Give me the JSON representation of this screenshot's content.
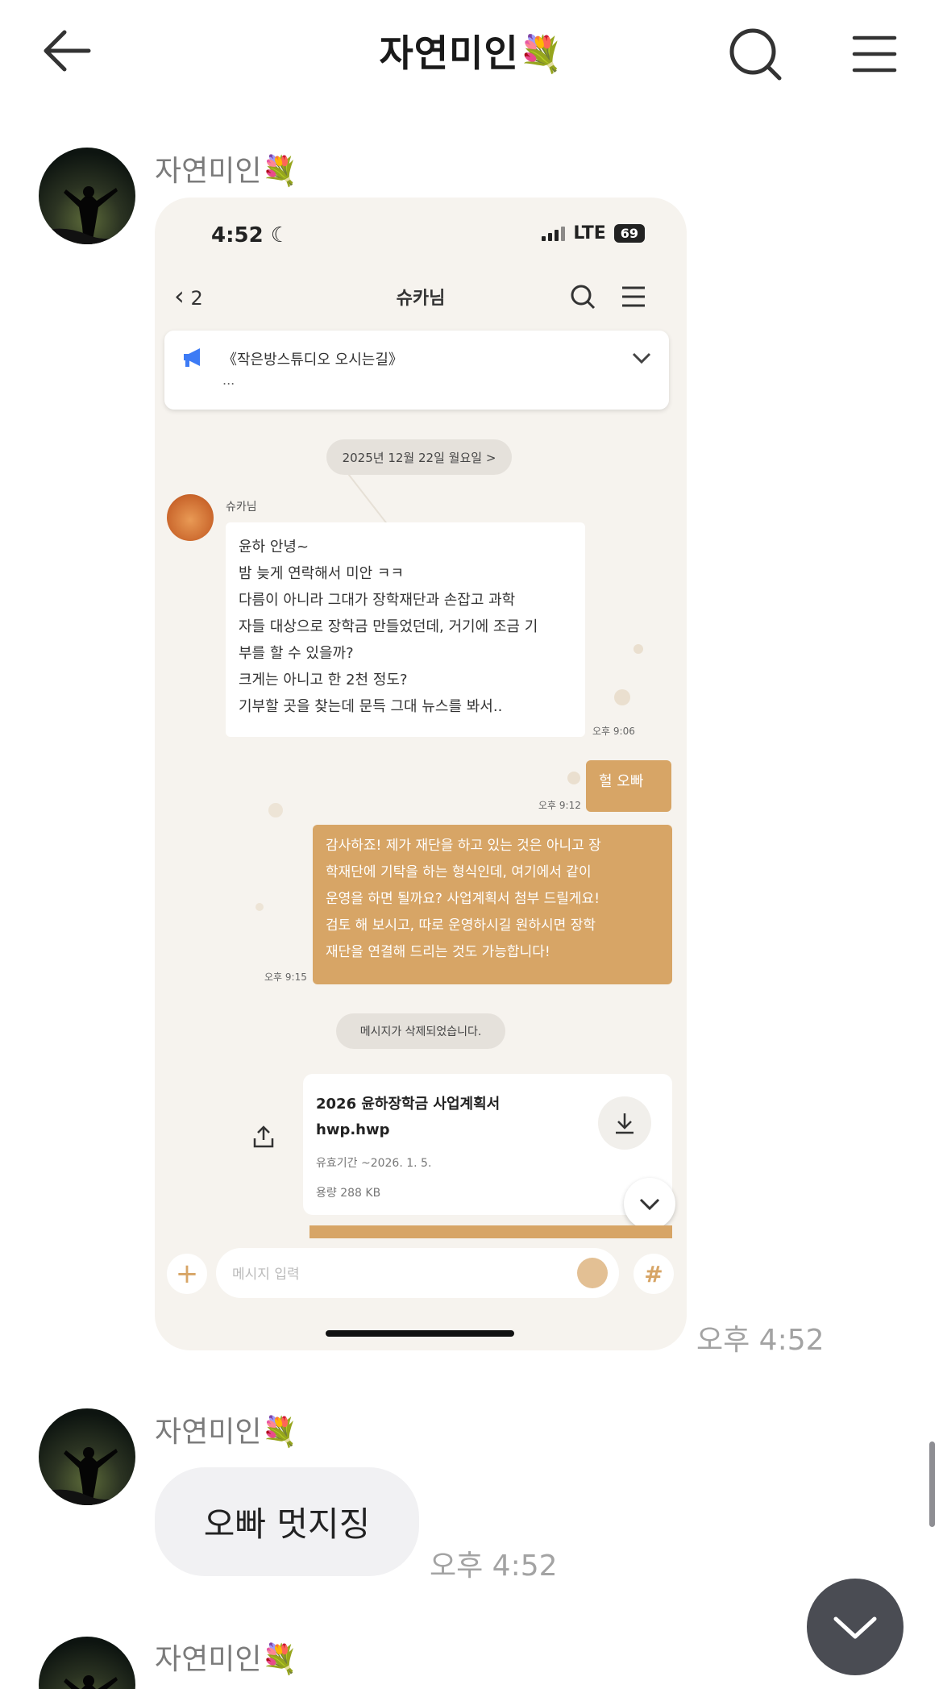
{
  "header": {
    "title": "자연미인",
    "title_emoji": "💐",
    "back_icon": "arrow-left-icon",
    "search_icon": "search-icon",
    "menu_icon": "hamburger-menu-icon"
  },
  "messages": [
    {
      "sender": "자연미인💐",
      "time": "오후 4:52",
      "type": "image",
      "screenshot": {
        "status_time": "4:52",
        "network": "LTE",
        "battery": "69",
        "back_count": "2",
        "chat_title": "슈카님",
        "notice_text": "《작은방스튜디오 오시는길》",
        "notice_sub": "...",
        "date_chip": "2025년 12월 22일 월요일 >",
        "msg_sender": "슈카님",
        "incoming_text": "윤하 안녕~\n밤 늦게 연락해서 미안 ㅋㅋ\n다름이 아니라 그대가 장학재단과 손잡고 과학\n자들 대상으로 장학금 만들었던데, 거기에 조금 기\n부를 할 수 있을까?\n크게는 아니고 한 2천 정도?\n기부할 곳을 찾는데 문득 그대 뉴스를 봐서..",
        "incoming_time": "오후 9:06",
        "reply1_text": "헐 오빠",
        "reply1_time": "오후 9:12",
        "reply2_text": "감사하죠! 제가 재단을 하고 있는 것은 아니고 장\n학재단에 기탁을 하는 형식인데, 여기에서 같이\n운영을 하면 될까요? 사업계획서 첨부 드릴게요!\n검토 해 보시고, 따로 운영하시길 원하시면 장학\n재단을 연결해 드리는 것도 가능합니다!",
        "reply2_time": "오후 9:15",
        "deleted_notice": "메시지가 삭제되었습니다.",
        "file_name": "2026 윤하장학금 사업계획서\nhwp.hwp",
        "file_validity": "유효기간  ~2026. 1. 5.",
        "file_size": "용량  288 KB",
        "input_placeholder": "메시지 입력",
        "hash_label": "#"
      }
    },
    {
      "sender": "자연미인💐",
      "time": "오후 4:52",
      "type": "text",
      "text": "오빠 멋지징"
    },
    {
      "sender": "자연미인💐",
      "type": "partial"
    }
  ],
  "colors": {
    "accent_brown": "#d7a566",
    "bubble_gray": "#f1f1f3",
    "time_gray": "#a3a3a3",
    "scroll_button": "#4a4c53"
  }
}
